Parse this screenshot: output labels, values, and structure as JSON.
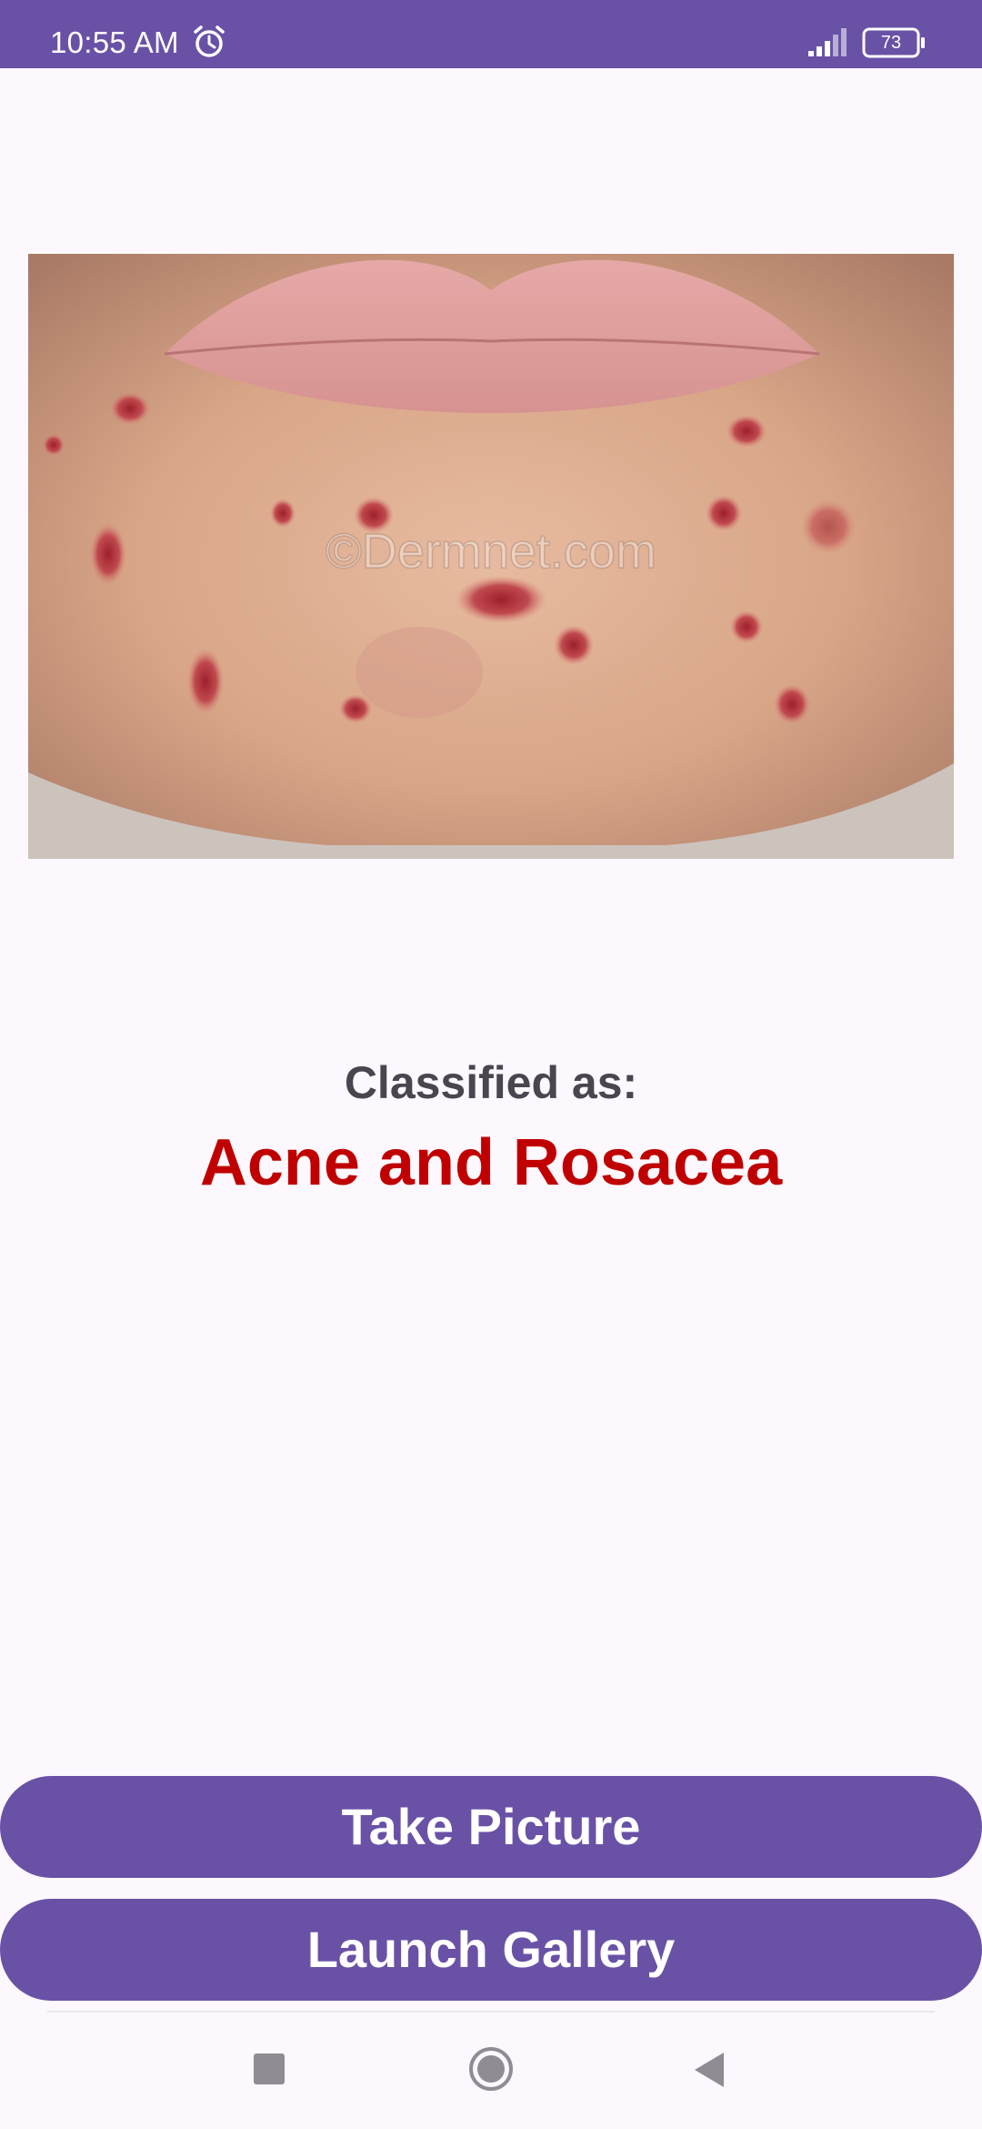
{
  "status_bar": {
    "time": "10:55 AM",
    "battery": "73",
    "icons": [
      "alarm-icon",
      "signal-icon",
      "battery-icon"
    ]
  },
  "photo": {
    "watermark": "©Dermnet.com"
  },
  "classification": {
    "label": "Classified as:",
    "result": "Acne and Rosacea"
  },
  "buttons": {
    "take_picture": "Take Picture",
    "launch_gallery": "Launch Gallery"
  },
  "nav_bar": {
    "icons": [
      "recents-icon",
      "home-icon",
      "back-icon"
    ]
  },
  "colors": {
    "primary": "#6951a6",
    "result": "#c00000",
    "label": "#4a4650",
    "background": "#fdf8fd"
  }
}
